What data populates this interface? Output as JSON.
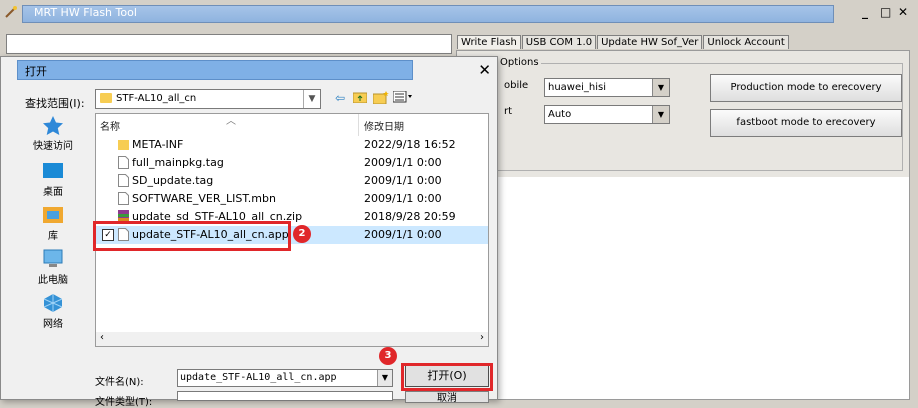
{
  "main_window": {
    "title": "MRT HW Flash Tool",
    "win_buttons": [
      "_",
      "□",
      "✕"
    ],
    "tabs": [
      "Write Flash",
      "USB COM 1.0",
      "Update HW Sof_Ver",
      "Unlock Account"
    ],
    "group_title": "Options",
    "label_mobile": "obile",
    "label_port": "rt",
    "mobile_value": "huawei_hisi",
    "port_value": "Auto",
    "btn_production": "Production mode to erecovery",
    "btn_fastboot": "fastboot mode to erecovery"
  },
  "dialog": {
    "title": "打开",
    "close": "✕",
    "lookin_label": "查找范围(I):",
    "lookin_value": "STF-AL10_all_cn",
    "toolbar_icons": [
      "back-arrow-icon",
      "up-folder-icon",
      "new-folder-icon",
      "view-menu-icon"
    ],
    "places": [
      "快速访问",
      "桌面",
      "库",
      "此电脑",
      "网络"
    ],
    "columns": {
      "name": "名称",
      "date": "修改日期"
    },
    "files": [
      {
        "name": "META-INF",
        "date": "2022/9/18 16:52",
        "type": "folder"
      },
      {
        "name": "full_mainpkg.tag",
        "date": "2009/1/1 0:00",
        "type": "file"
      },
      {
        "name": "SD_update.tag",
        "date": "2009/1/1 0:00",
        "type": "file"
      },
      {
        "name": "SOFTWARE_VER_LIST.mbn",
        "date": "2009/1/1 0:00",
        "type": "file"
      },
      {
        "name": "update_sd_STF-AL10_all_cn.zip",
        "date": "2018/9/28 20:59",
        "type": "zip"
      },
      {
        "name": "update_STF-AL10_all_cn.app",
        "date": "2009/1/1 0:00",
        "type": "file",
        "selected": true
      }
    ],
    "filename_label": "文件名(N):",
    "filename_value": "update_STF-AL10_all_cn.app",
    "filetype_label": "文件类型(T):",
    "open_button": "打开(O)",
    "cancel_button": "取消"
  },
  "annotations": {
    "badge_2": "2",
    "badge_3": "3"
  },
  "colors": {
    "highlight": "#e0272a",
    "selection": "#cce8ff",
    "folder": "#f7cd53"
  }
}
